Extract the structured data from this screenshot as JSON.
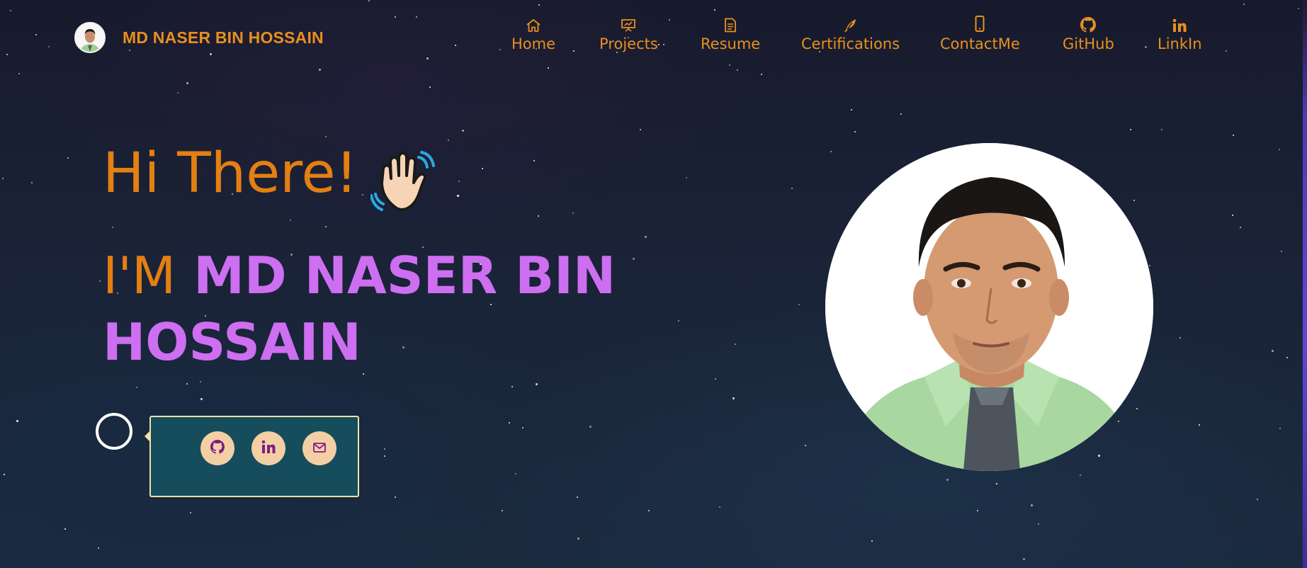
{
  "brand": {
    "name": "MD NASER BIN HOSSAIN",
    "avatar_icon": "profile-avatar"
  },
  "nav": {
    "items": [
      {
        "label": "Home",
        "icon": "home-icon"
      },
      {
        "label": "Projects",
        "icon": "presentation-icon"
      },
      {
        "label": "Resume",
        "icon": "document-icon"
      },
      {
        "label": "Certifications",
        "icon": "feather-icon"
      },
      {
        "label": "ContactMe",
        "icon": "phone-icon"
      },
      {
        "label": "GitHub",
        "icon": "github-icon"
      },
      {
        "label": "LinkIn",
        "icon": "linkedin-icon"
      }
    ]
  },
  "hero": {
    "greeting": "Hi There!",
    "greeting_emoji": "waving-hand-icon",
    "im_prefix": "I'M",
    "name": "MD NASER BIN HOSSAIN"
  },
  "social": {
    "buttons": [
      {
        "icon": "github-icon"
      },
      {
        "icon": "linkedin-icon"
      },
      {
        "icon": "mail-icon"
      }
    ]
  },
  "colors": {
    "accent_orange": "#e47f12",
    "name_purple": "#cd6ff0",
    "social_box_bg": "#164d5c",
    "social_btn_bg": "#f4cfa4",
    "social_icon": "#7a1f86"
  }
}
